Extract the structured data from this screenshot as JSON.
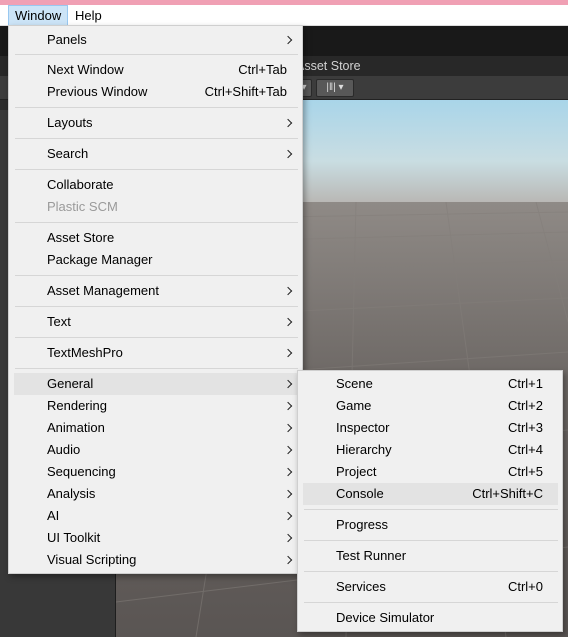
{
  "colors": {
    "accent_strip": "#f0a0b4",
    "menu_background": "#f0f0f0",
    "menu_hover": "#e3e3e3",
    "menubar_active": "#cce4f7",
    "disabled_text": "#9a9a9a"
  },
  "menubar": {
    "items": [
      {
        "label": "Window"
      },
      {
        "label": "Help"
      }
    ]
  },
  "editor": {
    "tab_asset_store": "Asset Store"
  },
  "window_menu": {
    "items": [
      {
        "label": "Panels",
        "submenu": true
      },
      {
        "label": "Next Window",
        "shortcut": "Ctrl+Tab"
      },
      {
        "label": "Previous Window",
        "shortcut": "Ctrl+Shift+Tab"
      },
      {
        "label": "Layouts",
        "submenu": true
      },
      {
        "label": "Search",
        "submenu": true
      },
      {
        "label": "Collaborate"
      },
      {
        "label": "Plastic SCM",
        "disabled": true
      },
      {
        "label": "Asset Store"
      },
      {
        "label": "Package Manager"
      },
      {
        "label": "Asset Management",
        "submenu": true
      },
      {
        "label": "Text",
        "submenu": true
      },
      {
        "label": "TextMeshPro",
        "submenu": true
      },
      {
        "label": "General",
        "submenu": true,
        "highlighted": true
      },
      {
        "label": "Rendering",
        "submenu": true
      },
      {
        "label": "Animation",
        "submenu": true
      },
      {
        "label": "Audio",
        "submenu": true
      },
      {
        "label": "Sequencing",
        "submenu": true
      },
      {
        "label": "Analysis",
        "submenu": true
      },
      {
        "label": "AI",
        "submenu": true
      },
      {
        "label": "UI Toolkit",
        "submenu": true
      },
      {
        "label": "Visual Scripting",
        "submenu": true
      }
    ]
  },
  "general_submenu": {
    "items": [
      {
        "label": "Scene",
        "shortcut": "Ctrl+1"
      },
      {
        "label": "Game",
        "shortcut": "Ctrl+2"
      },
      {
        "label": "Inspector",
        "shortcut": "Ctrl+3"
      },
      {
        "label": "Hierarchy",
        "shortcut": "Ctrl+4"
      },
      {
        "label": "Project",
        "shortcut": "Ctrl+5"
      },
      {
        "label": "Console",
        "shortcut": "Ctrl+Shift+C",
        "highlighted": true
      },
      {
        "label": "Progress"
      },
      {
        "label": "Test Runner"
      },
      {
        "label": "Services",
        "shortcut": "Ctrl+0"
      },
      {
        "label": "Device Simulator"
      }
    ]
  }
}
